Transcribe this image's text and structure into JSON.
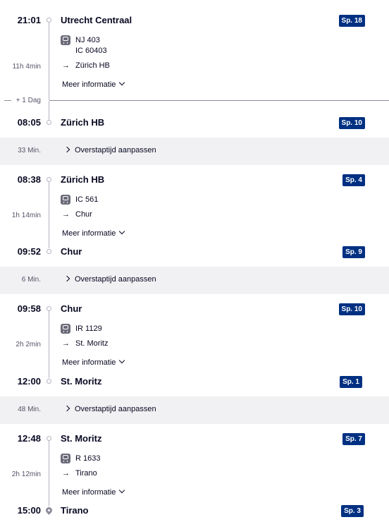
{
  "legs": [
    {
      "dep_time": "21:01",
      "dep_station": "Utrecht Centraal",
      "dep_platform": "Sp. 18",
      "train_lines": [
        "NJ 403",
        "IC 60403"
      ],
      "direction": "Zürich HB",
      "duration": "11h 4min",
      "more_info": "Meer informatie",
      "arr_time": "08:05",
      "arr_station": "Zürich HB",
      "arr_platform": "Sp. 10"
    },
    {
      "dep_time": "08:38",
      "dep_station": "Zürich HB",
      "dep_platform": "Sp. 4",
      "train_lines": [
        "IC 561"
      ],
      "direction": "Chur",
      "duration": "1h 14min",
      "more_info": "Meer informatie",
      "arr_time": "09:52",
      "arr_station": "Chur",
      "arr_platform": "Sp. 9"
    },
    {
      "dep_time": "09:58",
      "dep_station": "Chur",
      "dep_platform": "Sp. 10",
      "train_lines": [
        "IR 1129"
      ],
      "direction": "St. Moritz",
      "duration": "2h 2min",
      "more_info": "Meer informatie",
      "arr_time": "12:00",
      "arr_station": "St. Moritz",
      "arr_platform": "Sp. 1"
    },
    {
      "dep_time": "12:48",
      "dep_station": "St. Moritz",
      "dep_platform": "Sp. 7",
      "train_lines": [
        "R 1633"
      ],
      "direction": "Tirano",
      "duration": "2h 12min",
      "more_info": "Meer informatie",
      "arr_time": "15:00",
      "arr_station": "Tirano",
      "arr_platform": "Sp. 3"
    }
  ],
  "day_change": "+ 1 Dag",
  "transfers": [
    {
      "duration": "33 Min.",
      "label": "Overstaptijd aanpassen"
    },
    {
      "duration": "6 Min.",
      "label": "Overstaptijd aanpassen"
    },
    {
      "duration": "48 Min.",
      "label": "Overstaptijd aanpassen"
    }
  ],
  "arrow_glyph": "→",
  "colors": {
    "platform_badge": "#003082",
    "text": "#070721",
    "transfer_bg": "#f1f1f3"
  }
}
